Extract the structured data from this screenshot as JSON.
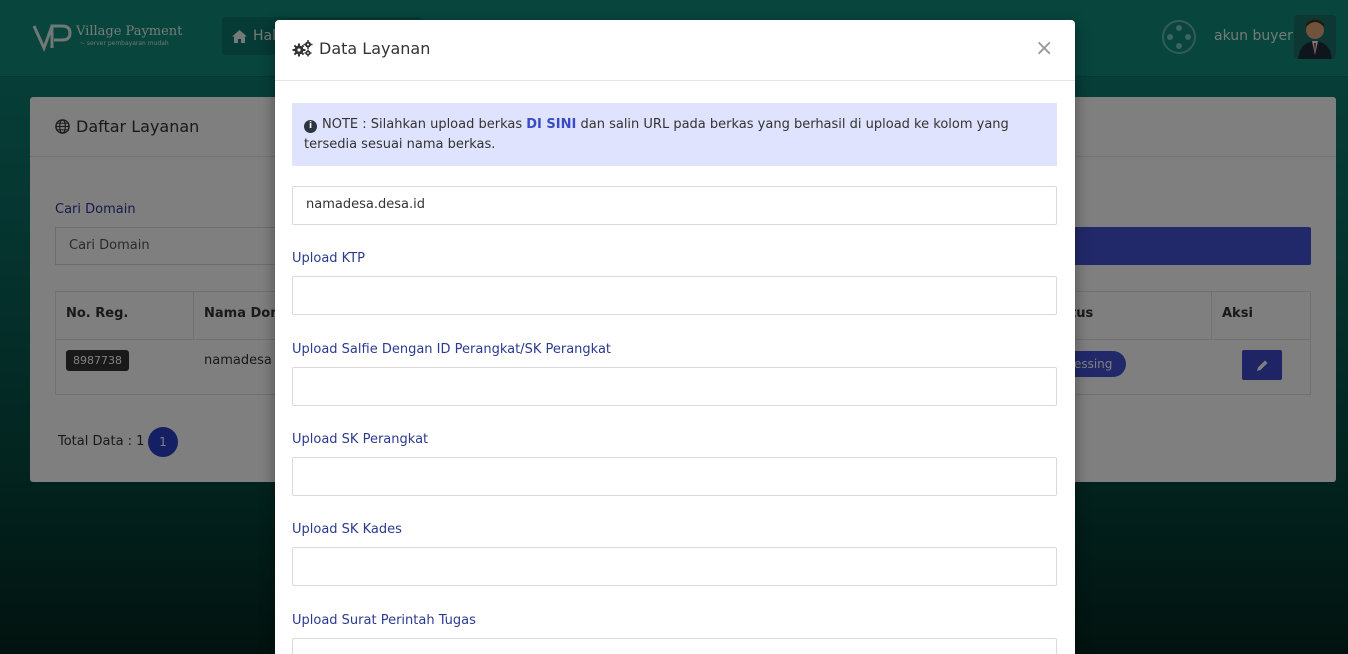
{
  "header": {
    "logo_title": "Village Payment",
    "logo_subtitle": "~ server pembayaran mudah",
    "nav_home_label": "Hal",
    "username": "akun buyer"
  },
  "card": {
    "title": "Daftar Layanan",
    "search_label": "Cari Domain",
    "search_placeholder": "Cari Domain",
    "columns": [
      "No. Reg.",
      "Nama Dom",
      "tus",
      "Aksi"
    ],
    "rows": [
      {
        "reg": "8987738",
        "domain": "namadesa",
        "status": "ocessing"
      }
    ],
    "total_label": "Total Data : 1",
    "page": "1"
  },
  "modal": {
    "title": "Data Layanan",
    "close": "×",
    "note_prefix": "NOTE : Silahkan upload berkas",
    "note_link": "DI SINI",
    "note_suffix": "dan salin URL pada berkas yang berhasil di upload ke kolom yang tersedia sesuai nama berkas.",
    "domain_value": "namadesa.desa.id",
    "fields": [
      {
        "label": "Upload KTP",
        "value": ""
      },
      {
        "label": "Upload Salfie Dengan ID Perangkat/SK Perangkat",
        "value": ""
      },
      {
        "label": "Upload SK Perangkat",
        "value": ""
      },
      {
        "label": "Upload SK Kades",
        "value": ""
      },
      {
        "label": "Upload Surat Perintah Tugas",
        "value": ""
      }
    ]
  },
  "colors": {
    "background": "#0f8a7a",
    "accent": "#4453d6",
    "note_bg": "#dfe3fd",
    "label": "#2b3a8f"
  }
}
